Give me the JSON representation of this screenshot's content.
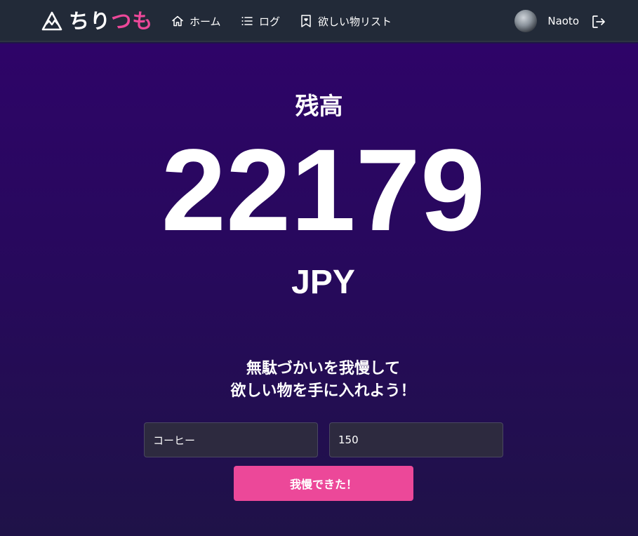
{
  "app": {
    "logo_part1": "ちり",
    "logo_part2": "つも",
    "accent_color": "#ec4899"
  },
  "nav": {
    "home": "ホーム",
    "log": "ログ",
    "wishlist": "欲しい物リスト"
  },
  "user": {
    "name": "Naoto"
  },
  "balance": {
    "label": "残高",
    "value": "22179",
    "currency": "JPY"
  },
  "slogan": {
    "line1": "無駄づかいを我慢して",
    "line2": "欲しい物を手に入れよう！"
  },
  "form": {
    "item_value": "コーヒー",
    "amount_value": "150",
    "submit_label": "我慢できた！"
  },
  "icons": {
    "logo": "mountain-icon",
    "home": "home-icon",
    "log": "list-icon",
    "wishlist": "bookmark-heart-icon",
    "logout": "logout-icon"
  }
}
